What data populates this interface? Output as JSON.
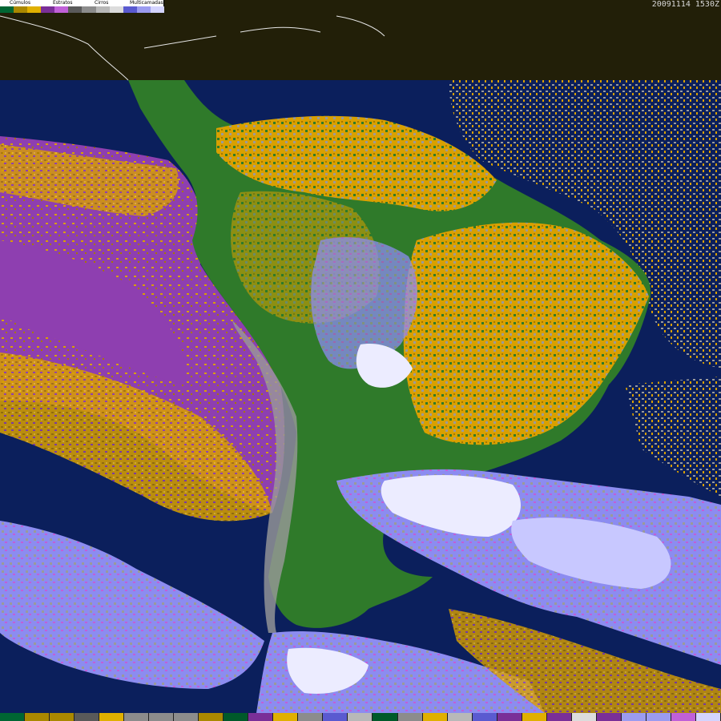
{
  "timestamp": "20091114 1530Z",
  "legend": {
    "labels": [
      "Cúmulos",
      "Estratos",
      "Cirros",
      "Multicamadas"
    ],
    "swatches": [
      "#006633",
      "#aa8800",
      "#e0b000",
      "#7a2f98",
      "#c060d8",
      "#5a5a5a",
      "#8c8c8c",
      "#b8b8b8",
      "#dcdcdc",
      "#5a5ad0",
      "#9b9bf0",
      "#d4d4ff"
    ]
  },
  "colors": {
    "ocean": "#0b1f5c",
    "land": "#2f7a2a",
    "land_dark": "#005a2a",
    "cumulus": "#d9a000",
    "cumulus_dark": "#a87800",
    "stratus": "#8e3fb0",
    "stratus_light": "#c060d8",
    "cirrus_gray": "#9a9a9a",
    "cirrus_light": "#cfcfcf",
    "multi_blue": "#8c8cf0",
    "multi_light": "#c8c8ff",
    "multi_white": "#ececff",
    "top_band": "#221f08",
    "coast": "#e6e6e6"
  },
  "bottom_strip": [
    "#006633",
    "#aa8800",
    "#aa8800",
    "#5a5a5a",
    "#e0b000",
    "#8c8c8c",
    "#8c8c8c",
    "#8c8c8c",
    "#aa8800",
    "#005a2a",
    "#7a2f98",
    "#e0b000",
    "#8c8c8c",
    "#5a5ad0",
    "#b8b8b8",
    "#005a2a",
    "#8c8c8c",
    "#e0b000",
    "#b8b8b8",
    "#5a5ad0",
    "#7a2f98",
    "#e0b000",
    "#7a2f98",
    "#dcdcdc",
    "#7a2f98",
    "#9b9bf0",
    "#9b9bf0",
    "#c060d8",
    "#d4d4ff"
  ]
}
